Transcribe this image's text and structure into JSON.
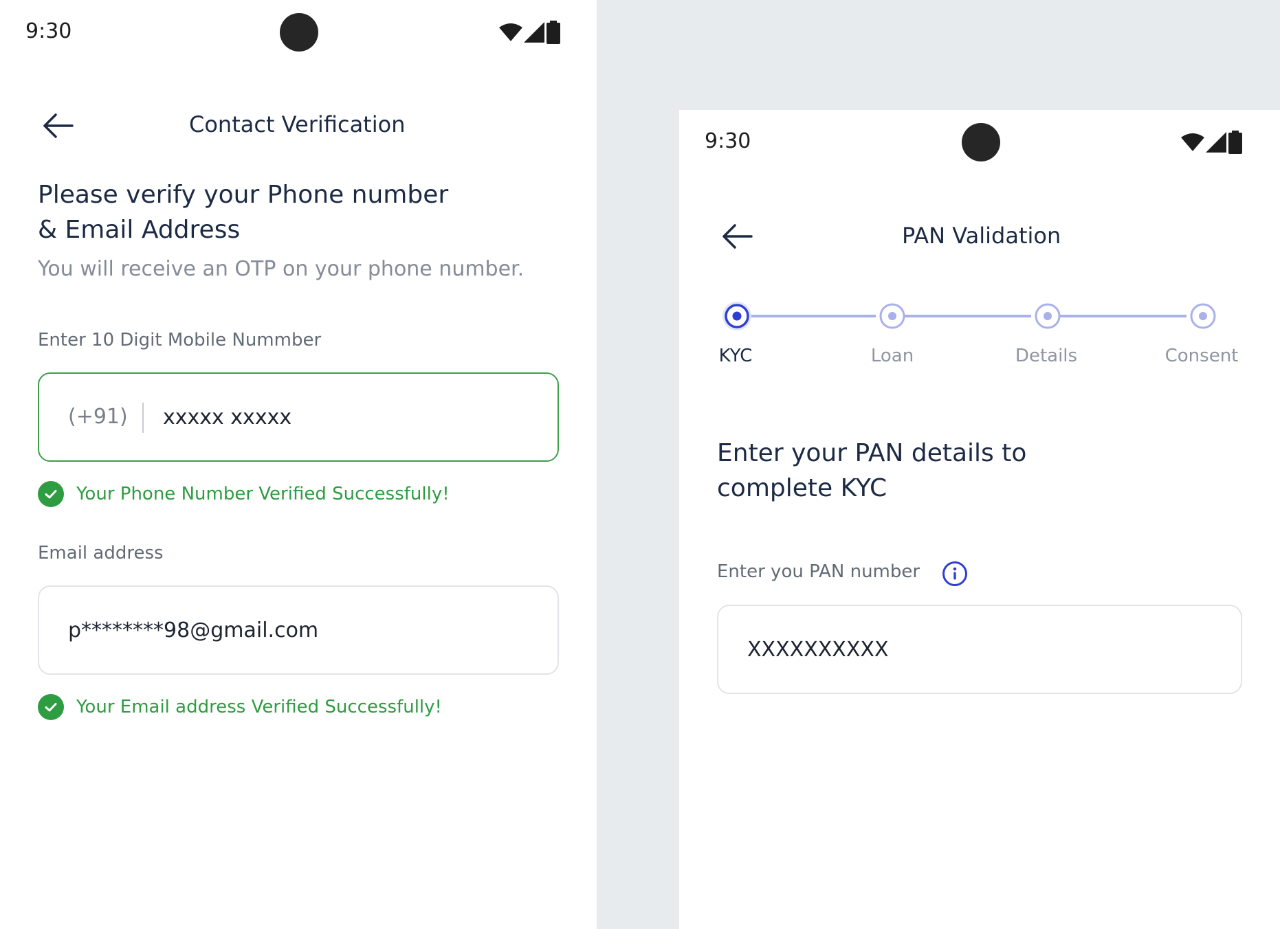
{
  "left": {
    "status": {
      "time": "9:30",
      "wifi_icon": "wifi-icon",
      "signal_icon": "signal-icon",
      "battery_icon": "battery-icon"
    },
    "header": {
      "title": "Contact Verification",
      "back_icon": "arrow-left-icon"
    },
    "heading_line1": "Please verify your Phone number",
    "heading_line2": "& Email Address",
    "subtext": "You will receive an OTP on your phone number.",
    "phone": {
      "label": "Enter 10 Digit Mobile Nummber",
      "prefix": "(+91)",
      "value": "xxxxx xxxxx",
      "success": "Your Phone Number Verified Successfully!"
    },
    "email": {
      "label": "Email address",
      "value": "p********98@gmail.com",
      "success": "Your Email address Verified Successfully!"
    },
    "colors": {
      "success": "#2e9c40",
      "field_border_ok": "#3e9e4c"
    }
  },
  "right": {
    "status": {
      "time": "9:30",
      "wifi_icon": "wifi-icon",
      "signal_icon": "signal-icon",
      "battery_icon": "battery-icon"
    },
    "header": {
      "title": "PAN Validation",
      "back_icon": "arrow-left-icon"
    },
    "stepper": {
      "steps": [
        {
          "label": "KYC",
          "state": "active"
        },
        {
          "label": "Loan",
          "state": "upcoming"
        },
        {
          "label": "Details",
          "state": "upcoming"
        },
        {
          "label": "Consent",
          "state": "upcoming"
        }
      ]
    },
    "heading_line1": "Enter your PAN details to",
    "heading_line2": "complete KYC",
    "pan": {
      "label": "Enter you PAN number",
      "value": "XXXXXXXXXX",
      "info_icon": "info-icon"
    },
    "colors": {
      "accent": "#2f3fd3",
      "step_light": "#a9b0ea"
    }
  }
}
